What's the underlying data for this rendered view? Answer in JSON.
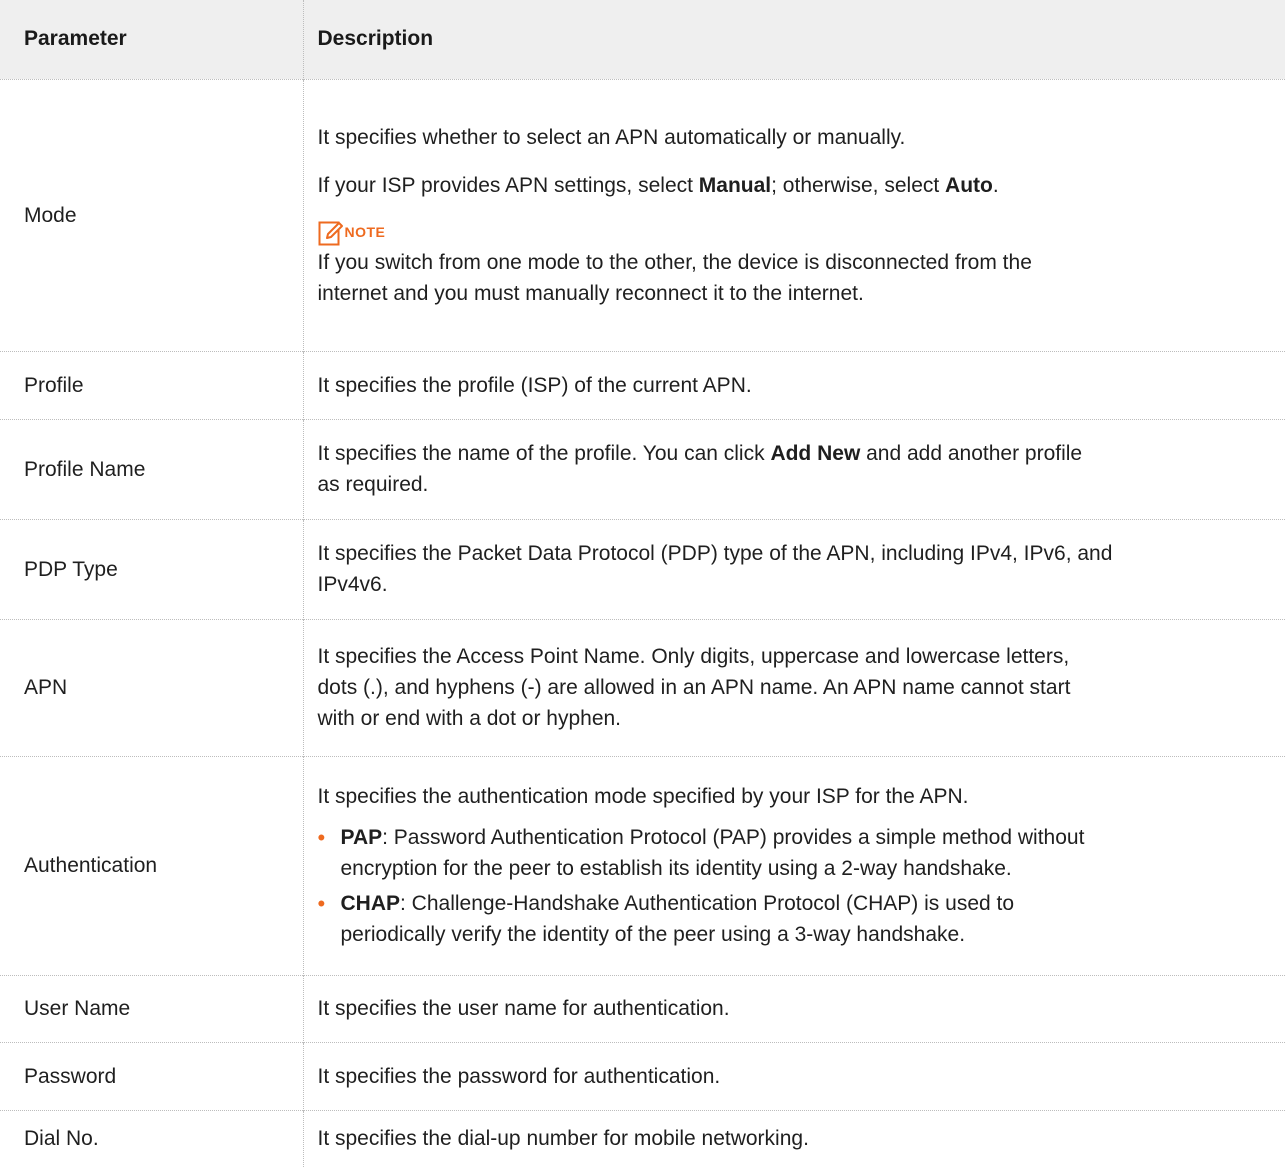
{
  "header": {
    "param": "Parameter",
    "desc": "Description"
  },
  "colors": {
    "accent": "#ee6a1f",
    "header_bg": "#efefef"
  },
  "rows": [
    {
      "param": "Mode",
      "p1": "It specifies whether to select an APN automatically or manually.",
      "p2_a": "If your ISP provides APN settings, select ",
      "p2_b": "Manual",
      "p2_c": "; otherwise, select ",
      "p2_d": "Auto",
      "p2_e": ".",
      "note_label": "NOTE",
      "note_icon": "edit-note-icon",
      "note_line1": "If you switch from one mode to the other, the device is disconnected from the",
      "note_line2": "internet and you must manually reconnect it to the internet."
    },
    {
      "param": "Profile",
      "desc": "It specifies the profile (ISP) of the current APN."
    },
    {
      "param": "Profile Name",
      "d_a": "It specifies the name of the profile. You can click ",
      "d_b": "Add New",
      "d_c": " and add another profile",
      "d_d": "as required."
    },
    {
      "param": "PDP Type",
      "line1": "It specifies the Packet Data Protocol (PDP) type of the APN, including IPv4, IPv6, and",
      "line2": "IPv4v6."
    },
    {
      "param": "APN",
      "line1": "It specifies the Access Point Name. Only digits, uppercase and lowercase letters,",
      "line2": "dots (.), and hyphens (-) are allowed in an APN name. An APN name cannot start",
      "line3": "with or end with a dot or hyphen."
    },
    {
      "param": "Authentication",
      "intro": "It specifies the authentication mode specified by your ISP for the APN.",
      "b1_term": "PAP",
      "b1_l1": ": Password Authentication Protocol (PAP) provides a simple method without",
      "b1_l2": "encryption for the peer to establish its identity using a 2-way handshake.",
      "b2_term": "CHAP",
      "b2_l1": ": Challenge-Handshake Authentication Protocol (CHAP) is used to",
      "b2_l2": "periodically verify the identity of the peer using a 3-way handshake."
    },
    {
      "param": "User Name",
      "desc": "It specifies the user name for authentication."
    },
    {
      "param": "Password",
      "desc": "It specifies the password for authentication."
    },
    {
      "param": "Dial No.",
      "desc": "It specifies the dial-up number for mobile networking."
    }
  ]
}
